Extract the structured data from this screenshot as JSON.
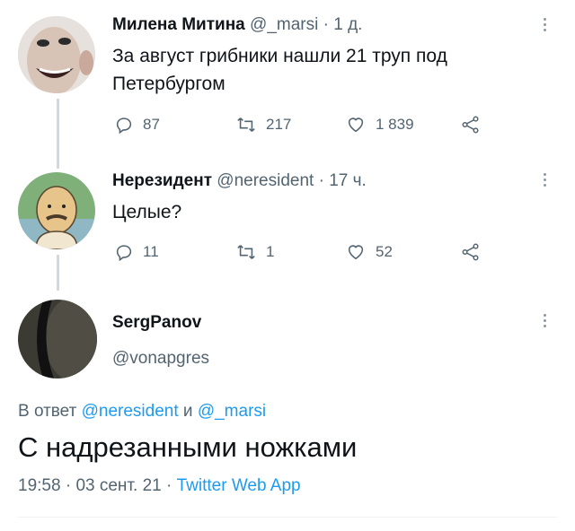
{
  "tweets": [
    {
      "display_name": "Милена Митина",
      "handle": "@_marsi",
      "separator": "·",
      "time": "1 д.",
      "text_line1": "За август грибники нашли 21 труп под",
      "text_line2": "Петербургом",
      "replies": "87",
      "retweets": "217",
      "likes": "1 839"
    },
    {
      "display_name": "Нерезидент",
      "handle": "@neresident",
      "separator": "·",
      "time": "17 ч.",
      "text_line1": "Целые?",
      "replies": "11",
      "retweets": "1",
      "likes": "52"
    }
  ],
  "main_tweet": {
    "display_name": "SergPanov",
    "handle": "@vonapgres",
    "reply_prefix": "В ответ",
    "reply_user1": "@neresident",
    "reply_joiner": "и",
    "reply_user2": "@_marsi",
    "text": "С надрезанными ножками",
    "time": "19:58",
    "separator1": "·",
    "date": "03 сент. 21",
    "separator2": "·",
    "source": "Twitter Web App"
  },
  "icons": {
    "reply": "reply-icon",
    "retweet": "retweet-icon",
    "like": "heart-icon",
    "share": "share-icon",
    "more": "more-vertical-icon"
  },
  "colors": {
    "link": "#1d9bf0",
    "secondary_text": "#536471",
    "thread_line": "#cfd9de"
  }
}
